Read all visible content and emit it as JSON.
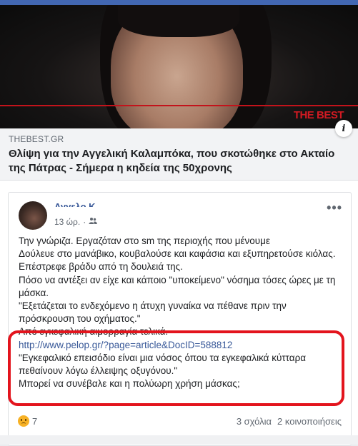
{
  "link_preview": {
    "watermark": "THE BEST",
    "domain": "THEBEST.GR",
    "headline": "Θλίψη για την Αγγελική Καλαμπόκα, που σκοτώθηκε στο Ακταίο της Πάτρας - Σήμερα η κηδεία της 50χρονης",
    "info_icon": "info-icon"
  },
  "post": {
    "author": "Αγγελο Κ...",
    "time": "13 ώρ.",
    "separator": "·",
    "privacy_icon": "friends-icon",
    "more": "•••",
    "lines": [
      "Την γνώριζα. Εργαζόταν στο sm της περιοχής που μένουμε",
      "Δούλευε στο μανάβικο, κουβαλούσε και καφάσια και εξυπηρετούσε κιόλας. Επέστρεφε βράδυ από τη δουλειά της.",
      "Πόσο να αντέξει αν είχε και κάποιο \"υποκείμενο\" νόσημα τόσες ώρες με τη μάσκα.",
      "\"Εξετάζεται το ενδεχόμενο η άτυχη γυναίκα να πέθανε πριν την πρόσκρουση του οχήματος.\"",
      "Από εγκεφαλική αιμορραγία τελικά."
    ],
    "link": "http://www.pelop.gr/?page=article&DocID=588812",
    "quote": "\"Εγκεφαλικό επεισόδιο είναι μια νόσος όπου τα εγκεφαλικά κύτταρα πεθαίνουν λόγω έλλειψης οξυγόνου.\"",
    "closing": "Μπορεί να συνέβαλε και η πολύωρη χρήση μάσκας;"
  },
  "footer": {
    "reaction_icon": "sad-reaction-icon",
    "reaction_count": "7",
    "comments": "3 σχόλια",
    "shares": "2 κοινοποιήσεις"
  },
  "colors": {
    "facebook_blue": "#4267b2",
    "highlight_red": "#e3141d",
    "link_blue": "#385898"
  }
}
